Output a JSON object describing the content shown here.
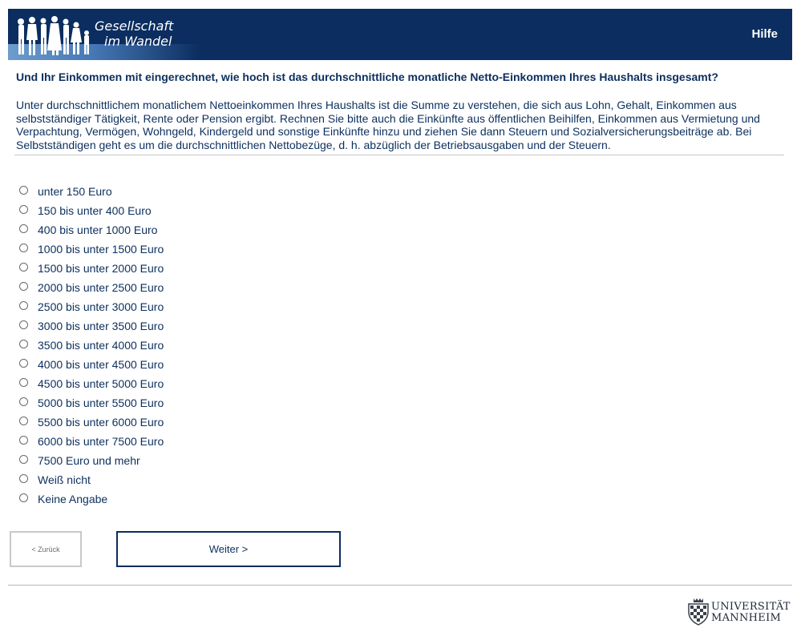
{
  "header": {
    "logo_line1": "Gesellschaft",
    "logo_line2": "im Wandel",
    "help_label": "Hilfe",
    "background_color": "#0b2d5f"
  },
  "question": "Und Ihr Einkommen mit eingerechnet, wie hoch ist das durchschnittliche monatliche Netto-Einkommen Ihres Haushalts insgesamt?",
  "explanation": "Unter durchschnittlichem monatlichem Nettoeinkommen Ihres Haushalts ist die Summe zu verstehen, die sich aus Lohn, Gehalt, Einkommen aus selbstständiger Tätigkeit, Rente oder Pension ergibt. Rechnen Sie bitte auch die Einkünfte aus öffentlichen Beihilfen, Einkommen aus Vermietung und Verpachtung, Vermögen, Wohngeld, Kindergeld und sonstige Einkünfte hinzu und ziehen Sie dann Steuern und Sozialversicherungsbeiträge ab. Bei Selbstständigen geht es um die durchschnittlichen Nettobezüge, d. h. abzüglich der Betriebsausgaben und der Steuern.",
  "options": [
    "unter 150 Euro",
    "150 bis unter 400 Euro",
    "400 bis unter 1000 Euro",
    "1000 bis unter 1500 Euro",
    "1500 bis unter 2000 Euro",
    "2000 bis unter 2500 Euro",
    "2500 bis unter 3000 Euro",
    "3000 bis unter 3500 Euro",
    "3500 bis unter 4000 Euro",
    "4000 bis unter 4500 Euro",
    "4500 bis unter 5000 Euro",
    "5000 bis unter 5500 Euro",
    "5500 bis unter 6000 Euro",
    "6000 bis unter 7500 Euro",
    "7500 Euro und mehr",
    "Weiß nicht",
    "Keine Angabe"
  ],
  "buttons": {
    "back_label": "< Zurück",
    "next_label": "Weiter >"
  },
  "footer": {
    "university_line1": "UNIVERSITÄT",
    "university_line2": "MANNHEIM"
  }
}
